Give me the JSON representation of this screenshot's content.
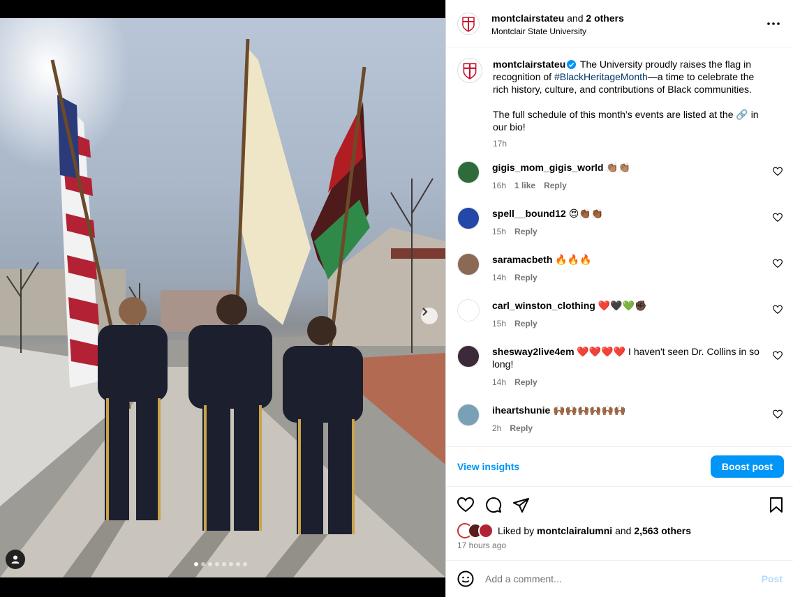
{
  "media": {
    "carousel_count": 8,
    "active_index": 0,
    "icons": {
      "next": "chevron-right-icon",
      "tag": "user-tag-icon"
    }
  },
  "header": {
    "username": "montclairstateu",
    "and_text": "and",
    "others": "2 others",
    "subtitle": "Montclair State University",
    "more_icon": "more-horizontal-icon"
  },
  "caption": {
    "username": "montclairstateu",
    "text_before": "The University proudly raises the flag in recognition of ",
    "hashtag": "#BlackHeritageMonth",
    "text_after": "—a time to celebrate the rich history, culture, and contributions of Black communities.",
    "text_second": "The full schedule of this month’s events are listed at the 🔗 in our bio!",
    "time": "17h"
  },
  "comments": [
    {
      "username": "gigis_mom_gigis_world",
      "text": "👏🏽👏🏽",
      "time": "16h",
      "likes": "1 like",
      "reply": "Reply",
      "avatar_color": "#2f6b3a"
    },
    {
      "username": "spell__bound12",
      "text": "😍👏🏾👏🏾",
      "time": "15h",
      "likes": "",
      "reply": "Reply",
      "avatar_color": "#2448a8"
    },
    {
      "username": "saramacbeth",
      "text": "🔥🔥🔥",
      "time": "14h",
      "likes": "",
      "reply": "Reply",
      "avatar_color": "#8a6a55"
    },
    {
      "username": "carl_winston_clothing",
      "text": "❤️🖤💚✊🏿",
      "time": "15h",
      "likes": "",
      "reply": "Reply",
      "avatar_color": "#ffffff"
    },
    {
      "username": "shesway2live4em",
      "text": "❤️❤️❤️❤️ I haven't seen Dr. Collins in so long!",
      "time": "14h",
      "likes": "",
      "reply": "Reply",
      "avatar_color": "#3a2a3a"
    },
    {
      "username": "iheartshunie",
      "text": "🙌🏾🙌🏾🙌🏾🙌🏾🙌🏾🙌🏾",
      "time": "2h",
      "likes": "",
      "reply": "Reply",
      "avatar_color": "#7aa0b8"
    }
  ],
  "insights": {
    "link": "View insights",
    "boost": "Boost post"
  },
  "actions": {
    "icons": [
      "heart-icon",
      "comment-icon",
      "share-icon",
      "bookmark-icon"
    ]
  },
  "likes": {
    "prefix": "Liked by",
    "user": "montclairalumni",
    "and_text": "and",
    "count": "2,563 others"
  },
  "timestamp": "17 hours ago",
  "add_comment": {
    "placeholder": "Add a comment...",
    "post": "Post",
    "emoji_icon": "emoji-icon"
  }
}
